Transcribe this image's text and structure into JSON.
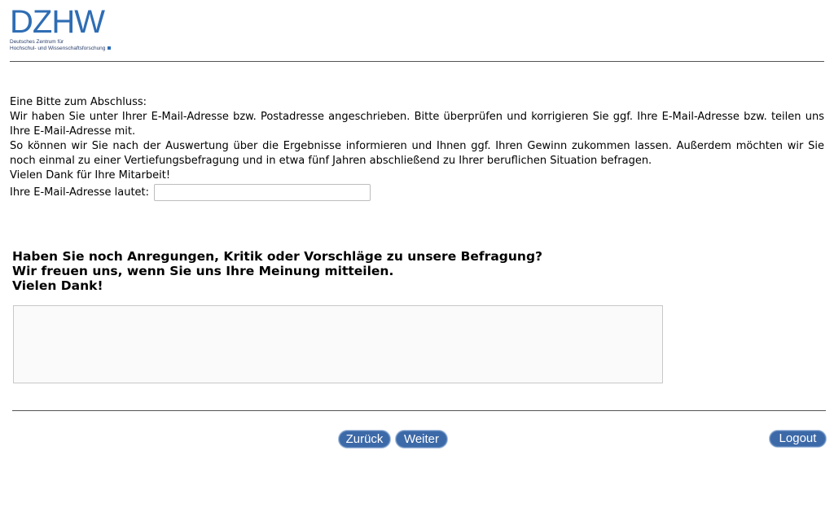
{
  "logo": {
    "mark": "DZHW",
    "line1": "Deutsches Zentrum für",
    "line2": "Hochschul- und Wissenschaftsforschung"
  },
  "intro": {
    "heading": "Eine Bitte zum Abschluss:",
    "paragraph1": "Wir haben Sie unter Ihrer E-Mail-Adresse bzw. Postadresse angeschrieben. Bitte überprüfen und korrigieren Sie ggf. Ihre E-Mail-Adresse bzw. teilen uns Ihre E-Mail-Adresse mit.",
    "paragraph2": "So können wir Sie nach der Auswertung über die Ergebnisse informieren und Ihnen ggf. Ihren Gewinn zukommen lassen. Außerdem möchten wir Sie noch einmal zu einer Vertiefungsbefragung und in etwa fünf Jahren abschließend zu Ihrer beruflichen Situation befragen.",
    "thanks": "Vielen Dank für Ihre Mitarbeit!",
    "email_label": "Ihre E-Mail-Adresse lautet:",
    "email_value": ""
  },
  "feedback": {
    "line1": "Haben Sie noch Anregungen, Kritik oder Vorschläge zu unsere Befragung?",
    "line2": "Wir freuen uns, wenn Sie uns Ihre Meinung mitteilen.",
    "line3": "Vielen Dank!",
    "value": ""
  },
  "nav": {
    "back_label": "Zurück",
    "next_label": "Weiter",
    "logout_label": "Logout"
  },
  "colors": {
    "brand": "#2e6db4",
    "button": "#3c69a8"
  }
}
